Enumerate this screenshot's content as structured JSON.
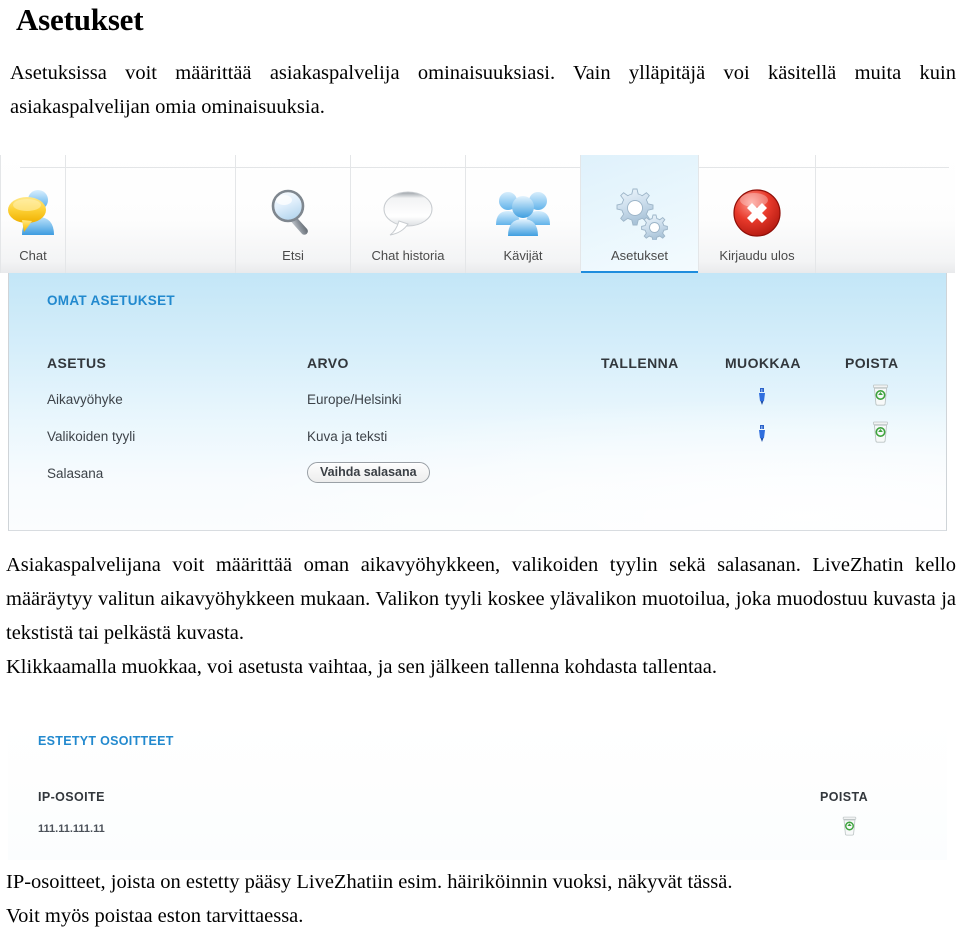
{
  "document": {
    "title": "Asetukset",
    "intro": "Asetuksissa voit määrittää asiakaspalvelija  ominaisuuksiasi. Vain ylläpitäjä voi käsitellä muita kuin asiakaspalvelijan omia ominaisuuksia.",
    "middle_paragraph": "Asiakaspalvelijana voit määrittää oman aikavyöhykkeen, valikoiden tyylin sekä salasanan. LiveZhatin kello määräytyy valitun aikavyöhykkeen mukaan. Valikon tyyli koskee ylävalikon muotoilua, joka muodostuu kuvasta ja tekstistä tai pelkästä kuvasta.",
    "middle_paragraph_last_line": "Klikkaamalla muokkaa, voi asetusta vaihtaa, ja sen jälkeen tallenna kohdasta tallentaa.",
    "bottom_paragraph": "IP-osoitteet, joista on estetty pääsy LiveZhatiin esim. häiriköinnin vuoksi, näkyvät tässä.",
    "bottom_paragraph_last_line": "Voit myös poistaa eston tarvittaessa."
  },
  "app": {
    "toolbar": {
      "tabs": [
        {
          "label": "Chat",
          "icon": "chat-bubbles-icon",
          "active": false
        },
        {
          "label": "",
          "icon": "",
          "active": false
        },
        {
          "label": "Etsi",
          "icon": "magnifier-icon",
          "active": false
        },
        {
          "label": "Chat historia",
          "icon": "speech-bubble-icon",
          "active": false
        },
        {
          "label": "Kävijät",
          "icon": "users-group-icon",
          "active": false
        },
        {
          "label": "Asetukset",
          "icon": "gears-icon",
          "active": true
        },
        {
          "label": "Kirjaudu ulos",
          "icon": "red-x-circle-icon",
          "active": false
        }
      ],
      "active_underline_color": "#1f8ddd"
    },
    "settings_panel": {
      "heading": "OMAT ASETUKSET",
      "columns": [
        "ASETUS",
        "ARVO",
        "TALLENNA",
        "MUOKKAA",
        "POISTA"
      ],
      "rows": [
        {
          "asetus": "Aikavyöhyke",
          "arvo": "Europe/Helsinki",
          "arvo_is_button": false,
          "tallenna": "",
          "muokkaa_icon": "edit-pencil-icon",
          "poista_icon": "trash-bin-icon"
        },
        {
          "asetus": "Valikoiden tyyli",
          "arvo": "Kuva ja teksti",
          "arvo_is_button": false,
          "tallenna": "",
          "muokkaa_icon": "edit-pencil-icon",
          "poista_icon": "trash-bin-icon"
        },
        {
          "asetus": "Salasana",
          "arvo": "Vaihda salasana",
          "arvo_is_button": true,
          "tallenna": "",
          "muokkaa_icon": "",
          "poista_icon": ""
        }
      ]
    },
    "blocked_panel": {
      "heading": "ESTETYT OSOITTEET",
      "columns": [
        "IP-OSOITE",
        "POISTA"
      ],
      "rows": [
        {
          "ip": "111.11.111.11",
          "poista_icon": "trash-bin-icon"
        }
      ]
    },
    "colors": {
      "heading_blue": "#2289ce",
      "accent_underline": "#1f8ddd",
      "panel_top": "#c3e6f7",
      "panel_bottom": "#fbfdfe"
    }
  }
}
